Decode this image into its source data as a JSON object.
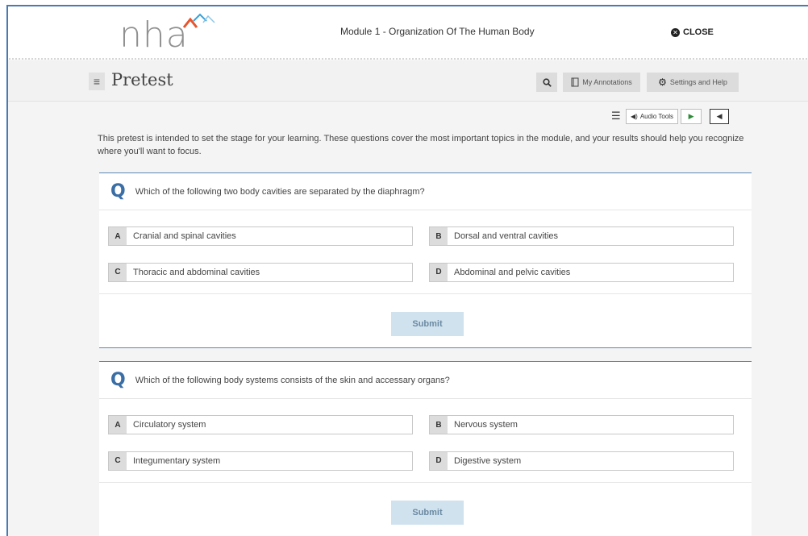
{
  "header": {
    "logo_text": "nha",
    "module_title": "Module 1 - Organization Of The Human Body",
    "close_label": "CLOSE"
  },
  "titlebar": {
    "page_title": "Pretest",
    "annotations_label": "My Annotations",
    "settings_label": "Settings and Help"
  },
  "audio": {
    "label": "Audio Tools"
  },
  "intro": "This pretest is intended to set the stage for your learning. These questions cover the most important topics in the module, and your results should help you recognize where you'll want to focus.",
  "questions": [
    {
      "mark": "Q",
      "text": "Which of the following two body cavities are separated by the diaphragm?",
      "options": [
        {
          "letter": "A",
          "text": "Cranial and spinal cavities"
        },
        {
          "letter": "B",
          "text": "Dorsal and ventral cavities"
        },
        {
          "letter": "C",
          "text": "Thoracic and abdominal cavities"
        },
        {
          "letter": "D",
          "text": "Abdominal and pelvic cavities"
        }
      ],
      "submit_label": "Submit"
    },
    {
      "mark": "Q",
      "text": "Which of the following body systems consists of the skin and accessary organs?",
      "options": [
        {
          "letter": "A",
          "text": "Circulatory system"
        },
        {
          "letter": "B",
          "text": "Nervous system"
        },
        {
          "letter": "C",
          "text": "Integumentary system"
        },
        {
          "letter": "D",
          "text": "Digestive system"
        }
      ],
      "submit_label": "Submit"
    }
  ],
  "colors": {
    "accent": "#3a6ea5",
    "submit_bg": "#d0e2ee",
    "play_green": "#2e8b3a",
    "logo_orange": "#e8542c",
    "logo_blue": "#3aa0d8"
  }
}
